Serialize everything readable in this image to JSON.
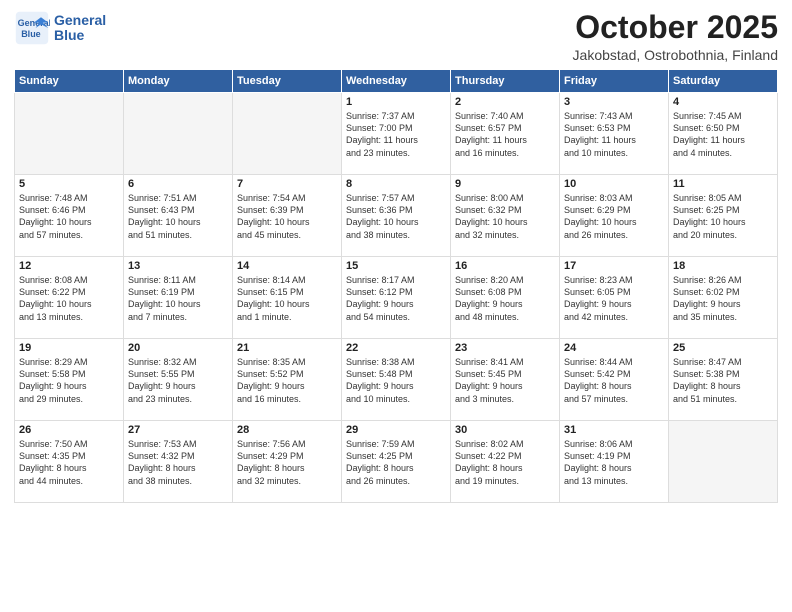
{
  "logo": {
    "name_line1": "General",
    "name_line2": "Blue"
  },
  "header": {
    "month": "October 2025",
    "location": "Jakobstad, Ostrobothnia, Finland"
  },
  "weekdays": [
    "Sunday",
    "Monday",
    "Tuesday",
    "Wednesday",
    "Thursday",
    "Friday",
    "Saturday"
  ],
  "weeks": [
    [
      {
        "day": "",
        "info": ""
      },
      {
        "day": "",
        "info": ""
      },
      {
        "day": "",
        "info": ""
      },
      {
        "day": "1",
        "info": "Sunrise: 7:37 AM\nSunset: 7:00 PM\nDaylight: 11 hours\nand 23 minutes."
      },
      {
        "day": "2",
        "info": "Sunrise: 7:40 AM\nSunset: 6:57 PM\nDaylight: 11 hours\nand 16 minutes."
      },
      {
        "day": "3",
        "info": "Sunrise: 7:43 AM\nSunset: 6:53 PM\nDaylight: 11 hours\nand 10 minutes."
      },
      {
        "day": "4",
        "info": "Sunrise: 7:45 AM\nSunset: 6:50 PM\nDaylight: 11 hours\nand 4 minutes."
      }
    ],
    [
      {
        "day": "5",
        "info": "Sunrise: 7:48 AM\nSunset: 6:46 PM\nDaylight: 10 hours\nand 57 minutes."
      },
      {
        "day": "6",
        "info": "Sunrise: 7:51 AM\nSunset: 6:43 PM\nDaylight: 10 hours\nand 51 minutes."
      },
      {
        "day": "7",
        "info": "Sunrise: 7:54 AM\nSunset: 6:39 PM\nDaylight: 10 hours\nand 45 minutes."
      },
      {
        "day": "8",
        "info": "Sunrise: 7:57 AM\nSunset: 6:36 PM\nDaylight: 10 hours\nand 38 minutes."
      },
      {
        "day": "9",
        "info": "Sunrise: 8:00 AM\nSunset: 6:32 PM\nDaylight: 10 hours\nand 32 minutes."
      },
      {
        "day": "10",
        "info": "Sunrise: 8:03 AM\nSunset: 6:29 PM\nDaylight: 10 hours\nand 26 minutes."
      },
      {
        "day": "11",
        "info": "Sunrise: 8:05 AM\nSunset: 6:25 PM\nDaylight: 10 hours\nand 20 minutes."
      }
    ],
    [
      {
        "day": "12",
        "info": "Sunrise: 8:08 AM\nSunset: 6:22 PM\nDaylight: 10 hours\nand 13 minutes."
      },
      {
        "day": "13",
        "info": "Sunrise: 8:11 AM\nSunset: 6:19 PM\nDaylight: 10 hours\nand 7 minutes."
      },
      {
        "day": "14",
        "info": "Sunrise: 8:14 AM\nSunset: 6:15 PM\nDaylight: 10 hours\nand 1 minute."
      },
      {
        "day": "15",
        "info": "Sunrise: 8:17 AM\nSunset: 6:12 PM\nDaylight: 9 hours\nand 54 minutes."
      },
      {
        "day": "16",
        "info": "Sunrise: 8:20 AM\nSunset: 6:08 PM\nDaylight: 9 hours\nand 48 minutes."
      },
      {
        "day": "17",
        "info": "Sunrise: 8:23 AM\nSunset: 6:05 PM\nDaylight: 9 hours\nand 42 minutes."
      },
      {
        "day": "18",
        "info": "Sunrise: 8:26 AM\nSunset: 6:02 PM\nDaylight: 9 hours\nand 35 minutes."
      }
    ],
    [
      {
        "day": "19",
        "info": "Sunrise: 8:29 AM\nSunset: 5:58 PM\nDaylight: 9 hours\nand 29 minutes."
      },
      {
        "day": "20",
        "info": "Sunrise: 8:32 AM\nSunset: 5:55 PM\nDaylight: 9 hours\nand 23 minutes."
      },
      {
        "day": "21",
        "info": "Sunrise: 8:35 AM\nSunset: 5:52 PM\nDaylight: 9 hours\nand 16 minutes."
      },
      {
        "day": "22",
        "info": "Sunrise: 8:38 AM\nSunset: 5:48 PM\nDaylight: 9 hours\nand 10 minutes."
      },
      {
        "day": "23",
        "info": "Sunrise: 8:41 AM\nSunset: 5:45 PM\nDaylight: 9 hours\nand 3 minutes."
      },
      {
        "day": "24",
        "info": "Sunrise: 8:44 AM\nSunset: 5:42 PM\nDaylight: 8 hours\nand 57 minutes."
      },
      {
        "day": "25",
        "info": "Sunrise: 8:47 AM\nSunset: 5:38 PM\nDaylight: 8 hours\nand 51 minutes."
      }
    ],
    [
      {
        "day": "26",
        "info": "Sunrise: 7:50 AM\nSunset: 4:35 PM\nDaylight: 8 hours\nand 44 minutes."
      },
      {
        "day": "27",
        "info": "Sunrise: 7:53 AM\nSunset: 4:32 PM\nDaylight: 8 hours\nand 38 minutes."
      },
      {
        "day": "28",
        "info": "Sunrise: 7:56 AM\nSunset: 4:29 PM\nDaylight: 8 hours\nand 32 minutes."
      },
      {
        "day": "29",
        "info": "Sunrise: 7:59 AM\nSunset: 4:25 PM\nDaylight: 8 hours\nand 26 minutes."
      },
      {
        "day": "30",
        "info": "Sunrise: 8:02 AM\nSunset: 4:22 PM\nDaylight: 8 hours\nand 19 minutes."
      },
      {
        "day": "31",
        "info": "Sunrise: 8:06 AM\nSunset: 4:19 PM\nDaylight: 8 hours\nand 13 minutes."
      },
      {
        "day": "",
        "info": ""
      }
    ]
  ]
}
